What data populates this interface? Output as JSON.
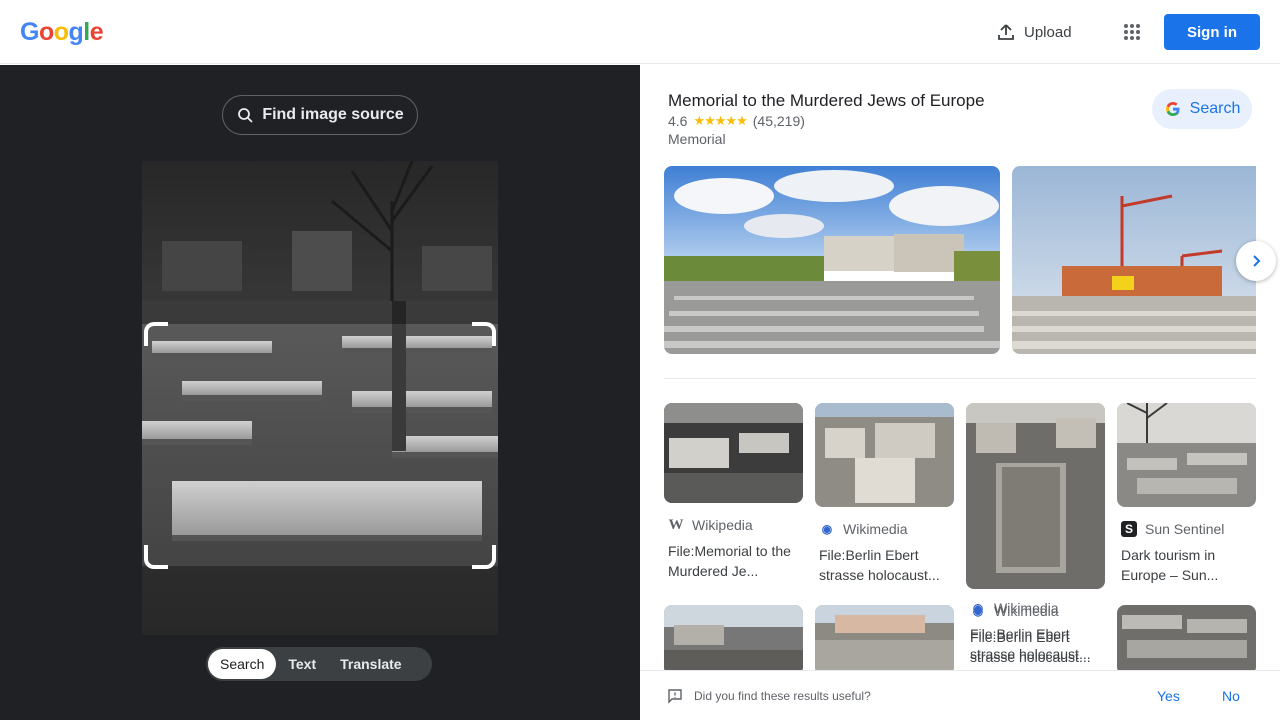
{
  "header": {
    "logo_letters": [
      {
        "ch": "G",
        "color": "#4285f4"
      },
      {
        "ch": "o",
        "color": "#ea4335"
      },
      {
        "ch": "o",
        "color": "#fbbc05"
      },
      {
        "ch": "g",
        "color": "#4285f4"
      },
      {
        "ch": "l",
        "color": "#34a853"
      },
      {
        "ch": "e",
        "color": "#ea4335"
      }
    ],
    "upload_label": "Upload",
    "sign_in_label": "Sign in"
  },
  "lens": {
    "find_source_label": "Find image source",
    "modes": [
      "Search",
      "Text",
      "Translate"
    ],
    "active_mode": "Search"
  },
  "entity": {
    "title": "Memorial to the Murdered Jews of Europe",
    "rating": "4.6",
    "stars": "★★★★★",
    "review_count": "(45,219)",
    "type": "Memorial",
    "search_label": "Search"
  },
  "results": [
    {
      "source": "Wikipedia",
      "icon": "wikipedia-icon",
      "icon_glyph": "W",
      "title": "File:Memorial to the Murdered Je..."
    },
    {
      "source": "Wikimedia",
      "icon": "wikimedia-icon",
      "icon_glyph": "◉",
      "title": "File:Berlin Ebert strasse holocaust..."
    },
    {
      "source": "Wikimedia",
      "icon": "wikimedia-icon",
      "icon_glyph": "◉",
      "title": "File:Berlin Ebert strasse holocaust..."
    },
    {
      "source": "Sun Sentinel",
      "icon": "sun-sentinel-icon",
      "icon_glyph": "S",
      "title": "Dark tourism in Europe – Sun..."
    }
  ],
  "feedback": {
    "question": "Did you find these results useful?",
    "yes_label": "Yes",
    "no_label": "No"
  }
}
